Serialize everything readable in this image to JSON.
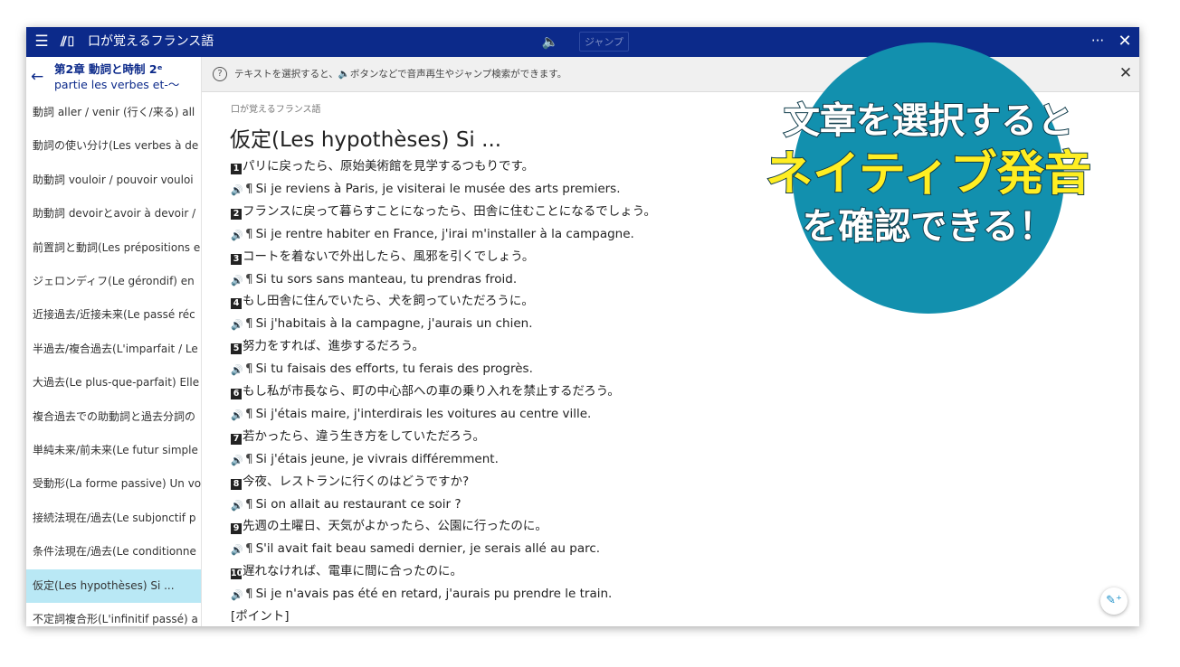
{
  "window": {
    "app_title": "口が覚えるフランス語",
    "jump_label": "ジャンプ",
    "icons": {
      "menu": "menu-icon",
      "book": "book-icon",
      "speaker": "speaker-icon",
      "more": "more-icon",
      "close": "close-icon"
    }
  },
  "sidebar": {
    "chapter_title": "第2章 動詞と時制 2ᵉ",
    "chapter_subtitle": "partie les verbes et-～",
    "items": [
      {
        "label": "動詞 aller / venir (行く/来る) all"
      },
      {
        "label": "動詞の使い分け(Les verbes à de"
      },
      {
        "label": "助動詞 vouloir / pouvoir vouloi"
      },
      {
        "label": "助動詞 devoirとavoir à devoir /"
      },
      {
        "label": "前置詞と動詞(Les prépositions e"
      },
      {
        "label": "ジェロンディフ(Le gérondif) en"
      },
      {
        "label": "近接過去/近接未来(Le passé réc"
      },
      {
        "label": "半過去/複合過去(L'imparfait / Le"
      },
      {
        "label": "大過去(Le plus-que-parfait) Elle"
      },
      {
        "label": "複合過去での助動詞と過去分詞の"
      },
      {
        "label": "単純未来/前未来(Le futur simple"
      },
      {
        "label": "受動形(La forme passive) Un vo"
      },
      {
        "label": "接続法現在/過去(Le subjonctif p"
      },
      {
        "label": "条件法現在/過去(Le conditionne"
      },
      {
        "label": "仮定(Les hypothèses) Si ...",
        "active": true
      },
      {
        "label": "不定詞複合形(L'infinitif passé) a"
      }
    ]
  },
  "infobar": {
    "message": "テキストを選択すると、🔈ボタンなどで音声再生やジャンプ検索ができます。"
  },
  "content": {
    "breadcrumb": "口が覚えるフランス語",
    "title": "仮定(Les hypothèses) Si ...",
    "lines": [
      {
        "kind": "jp",
        "num": "1",
        "text": "パリに戻ったら、原始美術館を見学するつもりです。"
      },
      {
        "kind": "fr",
        "text": "Si je reviens à Paris, je visiterai le musée des arts premiers."
      },
      {
        "kind": "jp",
        "num": "2",
        "text": "フランスに戻って暮らすことになったら、田舎に住むことになるでしょう。"
      },
      {
        "kind": "fr",
        "text": "Si je rentre habiter en France, j'irai m'installer à la campagne."
      },
      {
        "kind": "jp",
        "num": "3",
        "text": "コートを着ないで外出したら、風邪を引くでしょう。"
      },
      {
        "kind": "fr",
        "text": "Si tu sors sans manteau, tu prendras froid."
      },
      {
        "kind": "jp",
        "num": "4",
        "text": "もし田舎に住んでいたら、犬を飼っていただろうに。"
      },
      {
        "kind": "fr",
        "text": "Si j'habitais à la campagne, j'aurais un chien."
      },
      {
        "kind": "jp",
        "num": "5",
        "text": "努力をすれば、進歩するだろう。"
      },
      {
        "kind": "fr",
        "text": "Si tu faisais des efforts, tu ferais des progrès."
      },
      {
        "kind": "jp",
        "num": "6",
        "text": "もし私が市長なら、町の中心部への車の乗り入れを禁止するだろう。"
      },
      {
        "kind": "fr",
        "text": "Si j'étais maire, j'interdirais les voitures au centre ville."
      },
      {
        "kind": "jp",
        "num": "7",
        "text": "若かったら、違う生き方をしていただろう。"
      },
      {
        "kind": "fr",
        "text": "Si j'étais jeune, je vivrais différemment."
      },
      {
        "kind": "jp",
        "num": "8",
        "text": "今夜、レストランに行くのはどうですか?"
      },
      {
        "kind": "fr",
        "text": "Si on allait au restaurant ce soir ?"
      },
      {
        "kind": "jp",
        "num": "9",
        "text": "先週の土曜日、天気がよかったら、公園に行ったのに。"
      },
      {
        "kind": "fr",
        "text": "S'il avait fait beau samedi dernier, je serais allé au parc."
      },
      {
        "kind": "jp",
        "num": "10",
        "text": "遅れなければ、電車に間に合ったのに。"
      },
      {
        "kind": "fr",
        "text": "Si je n'avais pas été en retard, j'aurais pu prendre le train."
      },
      {
        "kind": "plain",
        "text": "[ポイント]"
      }
    ]
  },
  "promo": {
    "line1": "文章を選択すると",
    "line2": "ネイティブ発音",
    "line3": "を確認できる！",
    "circle_color": "#1290ae",
    "highlight_color": "#ffee22"
  }
}
